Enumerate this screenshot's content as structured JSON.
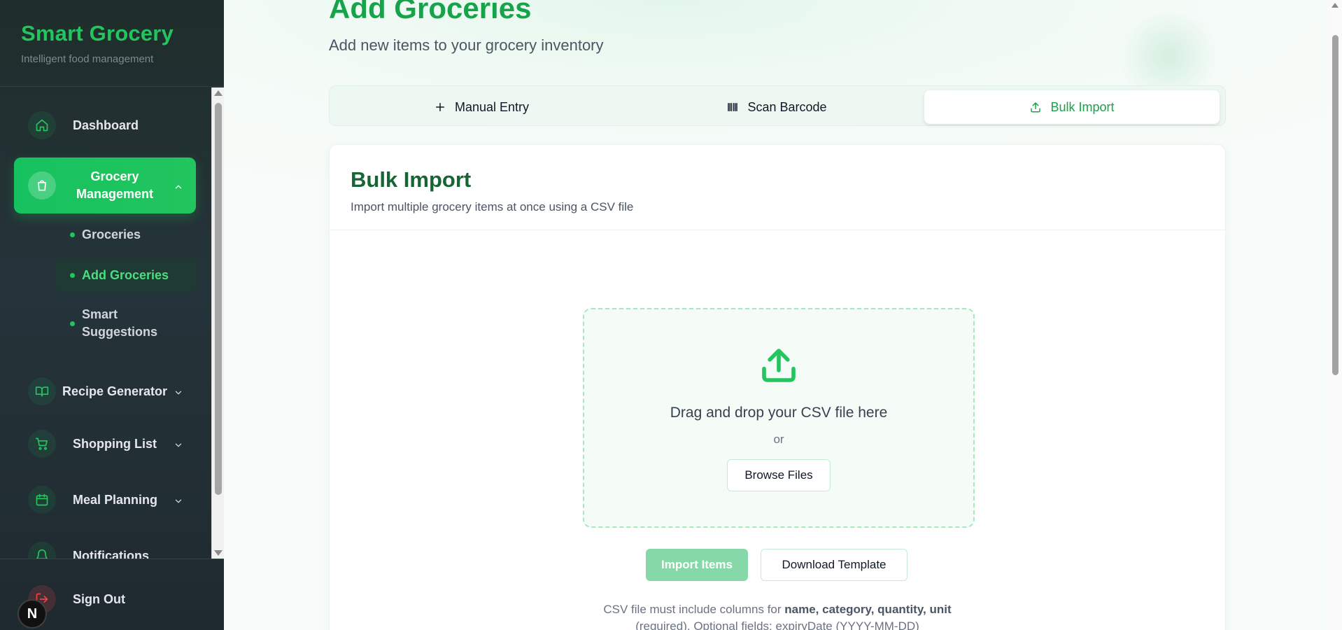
{
  "brand": {
    "title": "Smart Grocery",
    "subtitle": "Intelligent food management"
  },
  "nav": {
    "dashboard": "Dashboard",
    "grocery_management": "Grocery Management",
    "sub_items": [
      "Groceries",
      "Add Groceries",
      "Smart Suggestions"
    ],
    "recipe_generator": "Recipe Generator",
    "shopping_list": "Shopping List",
    "meal_planning": "Meal Planning",
    "notifications": "Notifications",
    "sign_out": "Sign Out",
    "active_sub_item": "Add Groceries"
  },
  "page": {
    "title": "Add Groceries",
    "subtitle": "Add new items to your grocery inventory"
  },
  "tabs": [
    {
      "label": "Manual Entry",
      "icon": "plus-icon"
    },
    {
      "label": "Scan Barcode",
      "icon": "barcode-icon"
    },
    {
      "label": "Bulk Import",
      "icon": "upload-icon",
      "active": true
    }
  ],
  "card": {
    "title": "Bulk Import",
    "subtitle": "Import multiple grocery items at once using a CSV file",
    "dropzone_text": "Drag and drop your CSV file here",
    "or_text": "or",
    "browse_label": "Browse Files",
    "import_label": "Import Items",
    "template_label": "Download Template",
    "hint_prefix": "CSV file must include columns for",
    "hint_columns": "name, category, quantity, unit",
    "hint_suffix": "(required). Optional fields: expiryDate (YYYY-MM-DD)"
  },
  "badge": "N",
  "colors": {
    "accent": "#22c55e",
    "sidebar_bg": "#1f2d2b",
    "title_green": "#16a34a"
  }
}
